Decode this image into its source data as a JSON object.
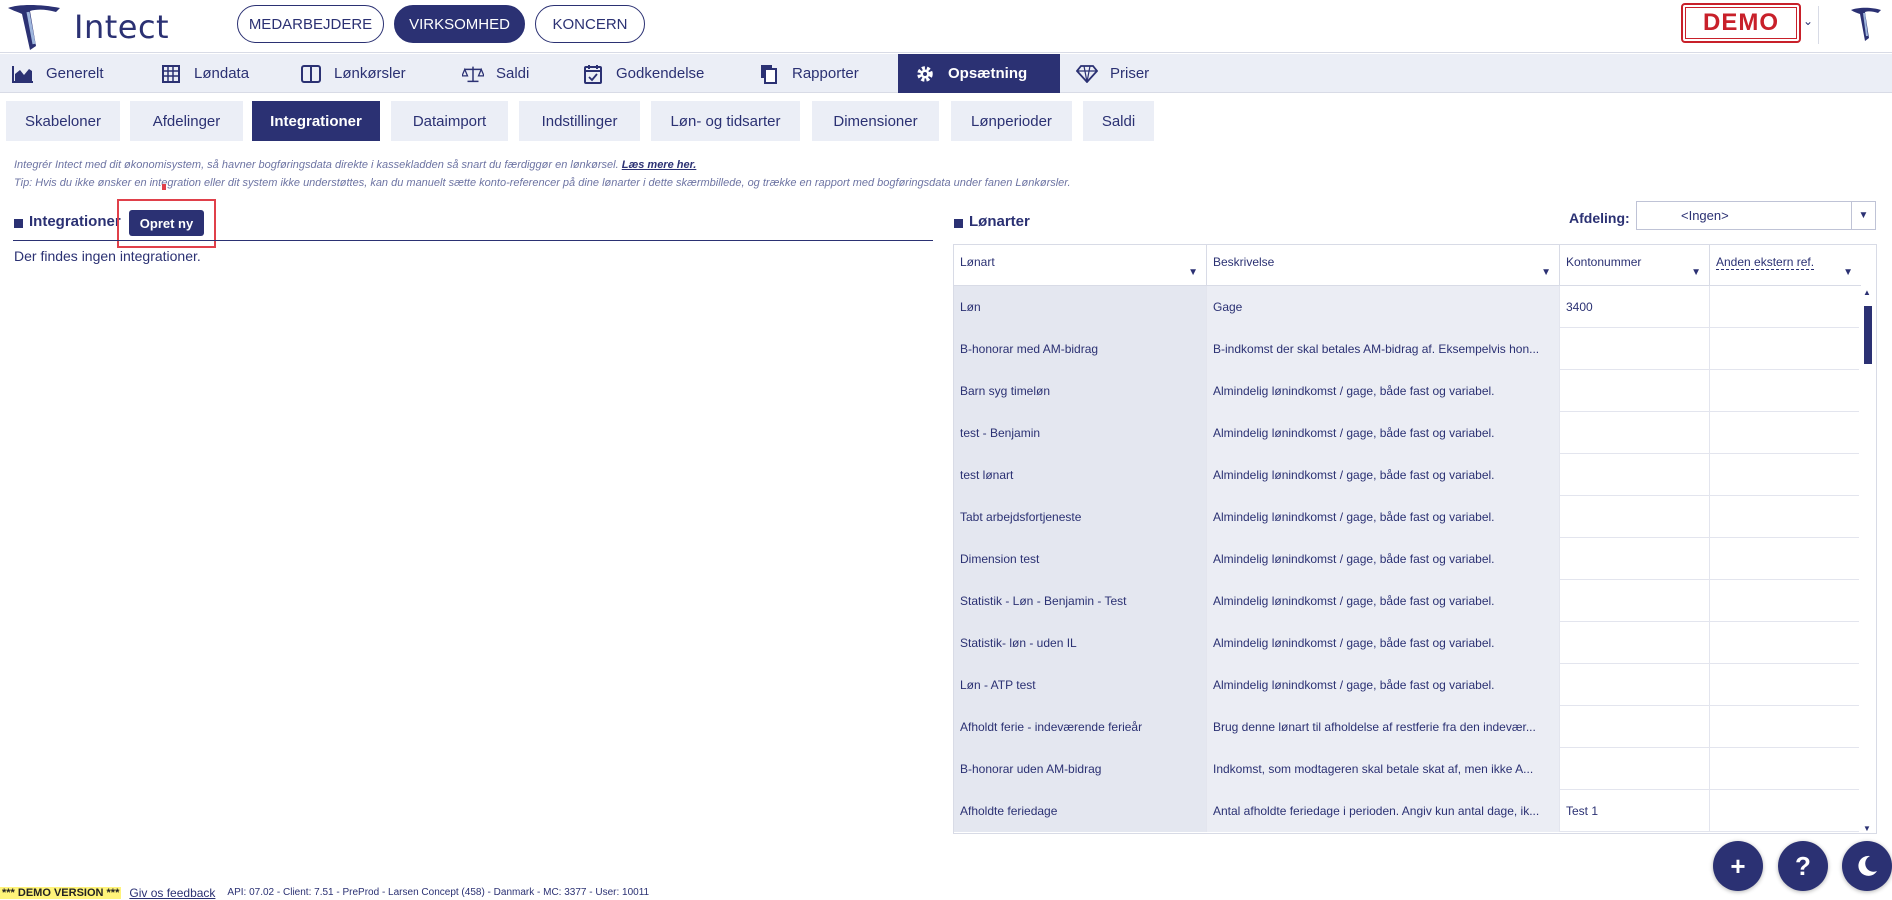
{
  "header": {
    "logo_text": "Intect",
    "pills": [
      "MEDARBEJDERE",
      "VIRKSOMHED",
      "KONCERN"
    ],
    "active_pill": "VIRKSOMHED",
    "demo_badge": "DEMO"
  },
  "main_nav": {
    "items": [
      {
        "label": "Generelt",
        "icon": "chart-area-icon"
      },
      {
        "label": "Løndata",
        "icon": "table-icon"
      },
      {
        "label": "Lønkørsler",
        "icon": "columns-icon"
      },
      {
        "label": "Saldi",
        "icon": "scale-icon"
      },
      {
        "label": "Godkendelse",
        "icon": "calendar-check-icon"
      },
      {
        "label": "Rapporter",
        "icon": "copy-icon"
      },
      {
        "label": "Opsætning",
        "icon": "gear-icon"
      },
      {
        "label": "Priser",
        "icon": "diamond-icon"
      }
    ],
    "active": "Opsætning"
  },
  "sub_tabs": {
    "items": [
      "Skabeloner",
      "Afdelinger",
      "Integrationer",
      "Dataimport",
      "Indstillinger",
      "Løn- og tidsarter",
      "Dimensioner",
      "Lønperioder",
      "Saldi"
    ],
    "active": "Integrationer"
  },
  "info": {
    "line1": "Integrér Intect med dit økonomisystem, så havner bogføringsdata direkte i kassekladden så snart du færdiggør en lønkørsel.",
    "line1_link": "Læs mere her.",
    "line2": "Tip: Hvis du ikke ønsker en integration eller dit system ikke understøttes, kan du manuelt sætte konto-referencer på dine lønarter i dette skærmbillede, og trække en rapport med bogføringsdata under fanen Lønkørsler."
  },
  "integrations": {
    "title": "Integrationer",
    "create_button": "Opret ny",
    "empty_message": "Der findes ingen integrationer."
  },
  "lonarter": {
    "title": "Lønarter",
    "department_label": "Afdeling:",
    "department_value": "<Ingen>",
    "columns": [
      "Lønart",
      "Beskrivelse",
      "Kontonummer",
      "Anden ekstern ref."
    ],
    "rows": [
      [
        "Løn",
        "Gage",
        "3400",
        ""
      ],
      [
        "B-honorar med AM-bidrag",
        "B-indkomst der skal betales AM-bidrag af. Eksempelvis hon...",
        "",
        ""
      ],
      [
        "Barn syg timeløn",
        "Almindelig lønindkomst / gage, både fast og variabel.",
        "",
        ""
      ],
      [
        "test - Benjamin",
        "Almindelig lønindkomst / gage, både fast og variabel.",
        "",
        ""
      ],
      [
        "test lønart",
        "Almindelig lønindkomst / gage, både fast og variabel.",
        "",
        ""
      ],
      [
        "Tabt arbejdsfortjeneste",
        "Almindelig lønindkomst / gage, både fast og variabel.",
        "",
        ""
      ],
      [
        "Dimension test",
        "Almindelig lønindkomst / gage, både fast og variabel.",
        "",
        ""
      ],
      [
        "Statistik - Løn - Benjamin - Test",
        "Almindelig lønindkomst / gage, både fast og variabel.",
        "",
        ""
      ],
      [
        "Statistik- løn - uden IL",
        "Almindelig lønindkomst / gage, både fast og variabel.",
        "",
        ""
      ],
      [
        "Løn - ATP test",
        "Almindelig lønindkomst / gage, både fast og variabel.",
        "",
        ""
      ],
      [
        "Afholdt ferie - indeværende ferieår",
        "Brug denne lønart til afholdelse af restferie fra den indevær...",
        "",
        ""
      ],
      [
        "B-honorar uden AM-bidrag",
        "Indkomst, som modtageren skal betale skat af, men ikke A...",
        "",
        ""
      ],
      [
        "Afholdte feriedage",
        "Antal afholdte feriedage i perioden. Angiv kun antal dage, ik...",
        "Test 1",
        ""
      ]
    ]
  },
  "fabs": [
    {
      "label": "+",
      "icon": "plus-icon"
    },
    {
      "label": "?",
      "icon": "help-icon"
    },
    {
      "label": "",
      "icon": "moon-icon"
    }
  ],
  "footer": {
    "demo_version": "*** DEMO VERSION ***",
    "feedback": "Giv os feedback",
    "meta": "API: 07.02 - Client: 7.51 - PreProd  - Larsen Concept (458) - Danmark - MC: 3377  - User: 10011"
  },
  "colors": {
    "primary": "#2b3173",
    "nav_bg": "#ebeef6",
    "demo_red": "#c8202a",
    "highlight": "#e0404a"
  }
}
